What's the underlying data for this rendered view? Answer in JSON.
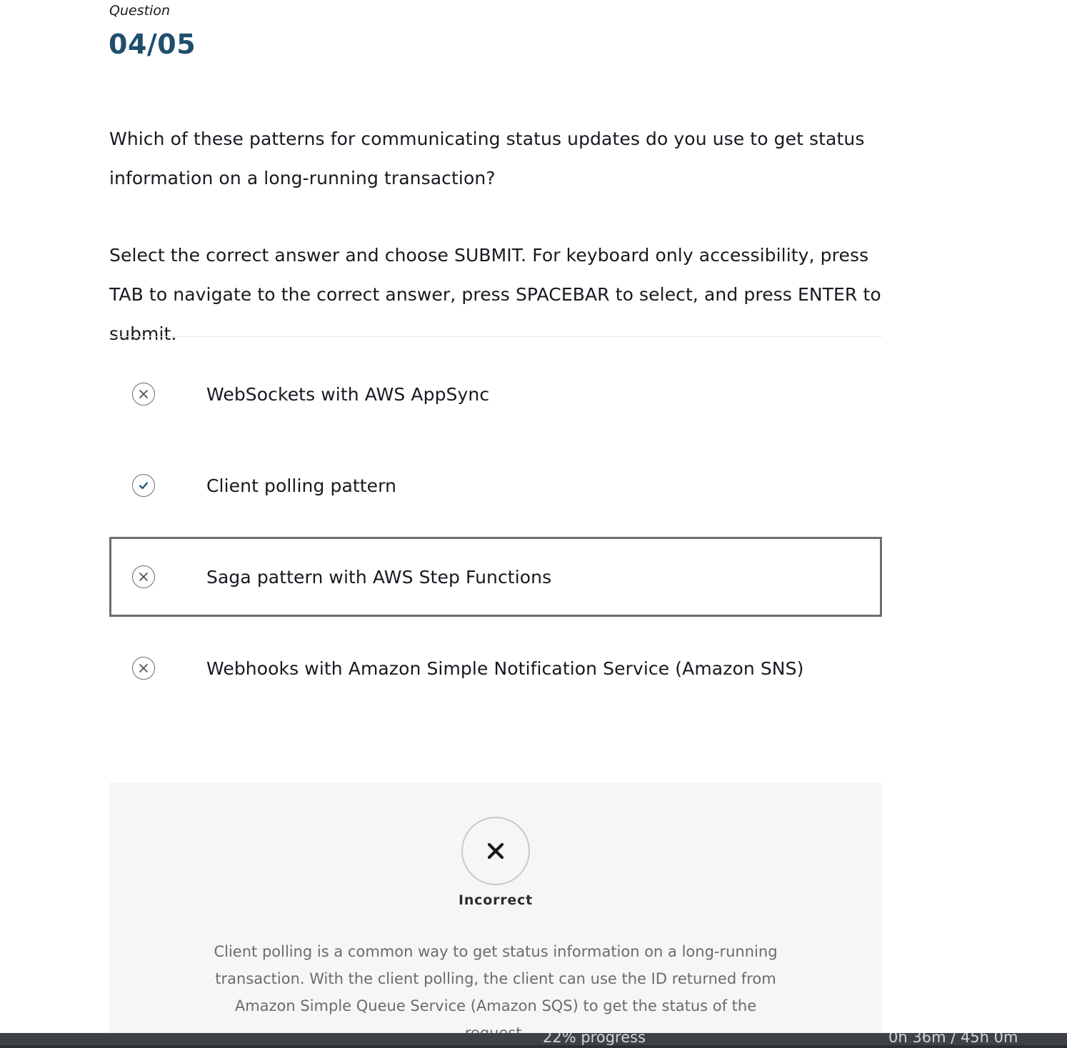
{
  "header": {
    "label": "Question",
    "number": "04/05"
  },
  "question": {
    "text": "Which of these patterns for communicating status updates do you use to get status information on a long-running transaction?",
    "instructions": "Select the correct answer and choose SUBMIT. For keyboard only accessibility, press TAB to navigate to the correct answer, press SPACEBAR to select, and press ENTER to submit."
  },
  "options": [
    {
      "label": "WebSockets with AWS AppSync",
      "status": "incorrect",
      "icon": "x-circle-icon"
    },
    {
      "label": "Client polling pattern",
      "status": "correct",
      "icon": "check-circle-icon"
    },
    {
      "label": "Saga pattern with AWS Step Functions",
      "status": "incorrect",
      "icon": "x-circle-icon",
      "selected": true
    },
    {
      "label": "Webhooks with Amazon Simple Notification Service (Amazon SNS)",
      "status": "incorrect",
      "icon": "x-circle-icon"
    }
  ],
  "feedback": {
    "icon": "x-icon",
    "title": "Incorrect",
    "text": "Client polling is a common way to get status information on a long-running transaction. With the client polling, the client can use the ID returned from Amazon Simple Queue Service (Amazon SQS) to get the status of the request."
  },
  "footer": {
    "progress": "22% progress",
    "time": "0h 36m / 45h 0m"
  },
  "colors": {
    "accent": "#1f4e6e",
    "check": "#1f4e6e",
    "bar": "#3e4247"
  }
}
